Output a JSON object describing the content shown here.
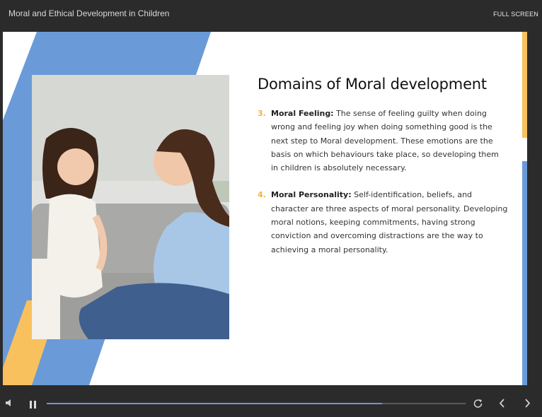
{
  "header": {
    "title": "Moral and Ethical Development in Children",
    "fullscreen_label": "FULL SCREEN"
  },
  "slide": {
    "heading": "Domains of Moral development",
    "points": [
      {
        "number": "3.",
        "term": "Moral Feeling:",
        "text": " The sense of feeling guilty when doing wrong and feeling joy when doing something good is the next step to Moral development. These emotions are the basis on which behaviours take place, so developing them in children is absolutely necessary."
      },
      {
        "number": "4.",
        "term": "Moral Personality:",
        "text": " Self-identification, beliefs, and character are three aspects of moral personality. Developing moral notions, keeping commitments, having strong conviction and overcoming distractions are the way to achieving a moral personality."
      }
    ],
    "photo_icon": "mother-and-daughter-photo"
  },
  "player": {
    "progress": 0.8,
    "icons": {
      "volume": "volume-icon",
      "pause": "pause-icon",
      "replay": "replay-icon",
      "prev": "chevron-left-icon",
      "next": "chevron-right-icon"
    }
  },
  "colors": {
    "accent_blue": "#6a9bd8",
    "accent_yellow": "#f8c15e",
    "number_color": "#f2b43a",
    "progress_fill": "#6f97d6"
  }
}
